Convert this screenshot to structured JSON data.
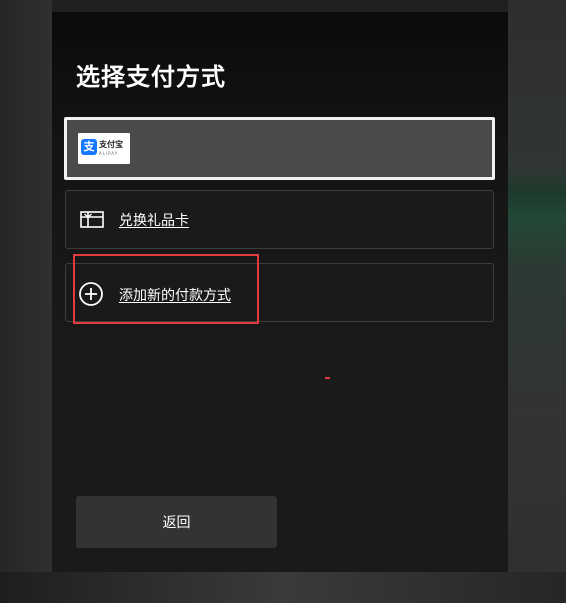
{
  "dialog": {
    "title": "选择支付方式",
    "back_label": "返回"
  },
  "payment_options": [
    {
      "id": "alipay",
      "selected": true,
      "logo_text": "支付宝",
      "logo_text_en": "ALIPAY",
      "logo_mark": "支",
      "icon": "alipay-logo"
    },
    {
      "id": "gift-card",
      "label": "兑换礼品卡",
      "icon": "gift-card-icon"
    },
    {
      "id": "add-new",
      "label": "添加新的付款方式",
      "icon": "plus-circle-icon"
    }
  ],
  "colors": {
    "panel_background": "#1a1a1a",
    "selected_background": "#4a4a4a",
    "selected_border": "#f2f2f2",
    "option_border": "#3d3d3d",
    "highlight_annotation": "#e23b3b",
    "alipay_blue": "#1677ff",
    "back_button": "#333333"
  }
}
